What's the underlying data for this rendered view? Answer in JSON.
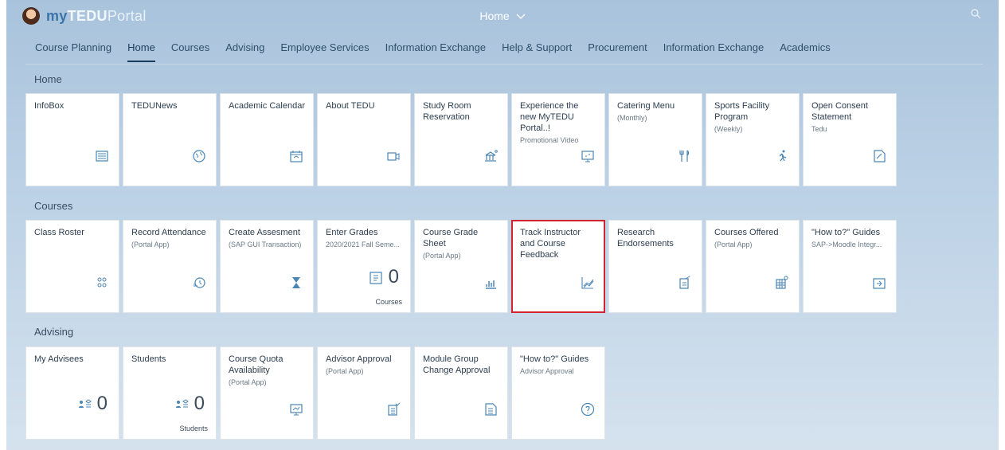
{
  "shell": {
    "title": "Home",
    "logo_text": "myTEDUPortal"
  },
  "tabs": [
    {
      "label": "Course Planning",
      "active": false
    },
    {
      "label": "Home",
      "active": true
    },
    {
      "label": "Courses",
      "active": false
    },
    {
      "label": "Advising",
      "active": false
    },
    {
      "label": "Employee Services",
      "active": false
    },
    {
      "label": "Information Exchange",
      "active": false
    },
    {
      "label": "Help & Support",
      "active": false
    },
    {
      "label": "Procurement",
      "active": false
    },
    {
      "label": "Information Exchange",
      "active": false
    },
    {
      "label": "Academics",
      "active": false
    }
  ],
  "sections": [
    {
      "title": "Home",
      "tiles": [
        {
          "title": "InfoBox",
          "subtitle": "",
          "icon": "newspaper-icon"
        },
        {
          "title": "TEDUNews",
          "subtitle": "",
          "icon": "globe-icon"
        },
        {
          "title": "Academic Calendar",
          "subtitle": "",
          "icon": "calendar-icon"
        },
        {
          "title": "About TEDU",
          "subtitle": "",
          "icon": "video-icon"
        },
        {
          "title": "Study Room Reservation",
          "subtitle": "",
          "icon": "building-icon"
        },
        {
          "title": "Experience the new MyTEDU Portal..!",
          "subtitle": "Promotional Video",
          "icon": "presentation-icon"
        },
        {
          "title": "Catering Menu",
          "subtitle": "(Monthly)",
          "icon": "cutlery-icon"
        },
        {
          "title": "Sports Facility Program",
          "subtitle": "(Weekly)",
          "icon": "running-icon"
        },
        {
          "title": "Open Consent Statement",
          "subtitle": "Tedu",
          "icon": "edit-document-icon"
        }
      ]
    },
    {
      "title": "Courses",
      "tiles": [
        {
          "title": "Class Roster",
          "subtitle": "",
          "icon": "group-icon"
        },
        {
          "title": "Record Attendance",
          "subtitle": "(Portal App)",
          "icon": "history-icon"
        },
        {
          "title": "Create Assesment",
          "subtitle": "(SAP GUI Transaction)",
          "icon": "hourglass-icon"
        },
        {
          "title": "Enter Grades",
          "subtitle": "2020/2021 Fall Seme...",
          "icon": "grade-sheet-icon",
          "number": "0",
          "footer": "Courses"
        },
        {
          "title": "Course Grade Sheet",
          "subtitle": "(Portal App)",
          "icon": "bar-chart-icon"
        },
        {
          "title": "Track Instructor and Course Feedback",
          "subtitle": "",
          "icon": "line-chart-icon",
          "highlight": true
        },
        {
          "title": "Research Endorsements",
          "subtitle": "",
          "icon": "document-sign-icon"
        },
        {
          "title": "Courses Offered",
          "subtitle": "(Portal App)",
          "icon": "table-search-icon"
        },
        {
          "title": "\"How to?\" Guides",
          "subtitle": "SAP->Moodle Integr...",
          "icon": "export-icon"
        }
      ]
    },
    {
      "title": "Advising",
      "tiles": [
        {
          "title": "My Advisees",
          "subtitle": "",
          "icon": "students-icon",
          "number": "0"
        },
        {
          "title": "Students",
          "subtitle": "",
          "icon": "students-icon",
          "number": "0",
          "footer": "Students"
        },
        {
          "title": "Course Quota Availability",
          "subtitle": "(Portal App)",
          "icon": "monitor-chart-icon"
        },
        {
          "title": "Advisor Approval",
          "subtitle": "(Portal App)",
          "icon": "approval-doc-icon"
        },
        {
          "title": "Module Group Change Approval",
          "subtitle": "",
          "icon": "document-list-icon"
        },
        {
          "title": "\"How to?\" Guides",
          "subtitle": "Advisor Approval",
          "icon": "question-icon"
        }
      ]
    }
  ]
}
